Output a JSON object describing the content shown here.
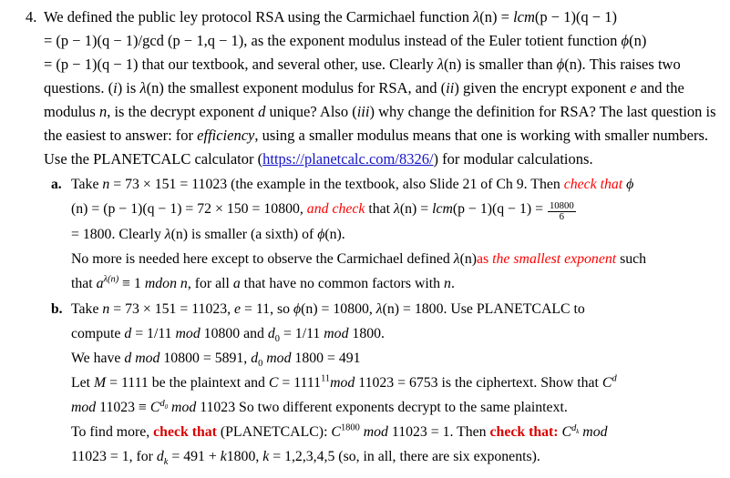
{
  "document": {
    "question_number": "4.",
    "colors": {
      "text": "#000000",
      "emphasis_red": "#ff0000",
      "bold_red": "#d90000",
      "link_blue": "#1414c8"
    },
    "intro": {
      "seg_1": "We defined the public ley protocol RSA using the  Carmichael function ",
      "lambda": "λ",
      "of_n_1": "(n) = ",
      "lcm": "lcm",
      "lcm_args": "(p − 1)(q − 1)",
      "seg_2": "= (p − 1)(q − 1)/gcd (p − 1,q − 1), as the exponent modulus instead of the Euler totient function ",
      "phi": "ϕ",
      "phi_of_n": "(n)",
      "seg_3": "= (p − 1)(q − 1) that our textbook, and several other, use. Clearly ",
      "lambda_2": "λ",
      "of_n_2": "(n) is smaller than ",
      "phi_2": "ϕ",
      "of_n_3": "(n). This raises",
      "seg_4": "two questions. (",
      "roman_i": "i",
      "seg_5": ") is ",
      "lambda_3": "λ",
      "seg_6": "(n) the smallest exponent modulus for RSA, and (",
      "roman_ii": "ii",
      "seg_7": ") given the encrypt exponent ",
      "var_e": "e",
      "seg_8": "and the modulus ",
      "var_n": "n",
      "seg_9": ", is the decrypt exponent ",
      "var_d": "d",
      "seg_10": " unique? Also (",
      "roman_iii": "iii",
      "seg_11": ") why change the definition for RSA? The",
      "seg_12": "last question is the easiest to answer: for ",
      "efficiency": "efficiency",
      "seg_13": ", using a smaller modulus means that one is working",
      "seg_14": "with smaller numbers. Use the PLANETCALC calculator (",
      "link_text": "https://planetcalc.com/8326/",
      "seg_15": ") for modular",
      "seg_16": "calculations."
    },
    "part_a": {
      "marker": "a.",
      "l1_p1": "Take ",
      "l1_n": "n",
      "l1_p2": " = 73 × 151 = 11023 (the example in the textbook, also Slide 21 of Ch 9. Then ",
      "l1_red_italic": "check that",
      "l1_phi": "ϕ",
      "l2_p1": "(n) = (p − 1)(q − 1) = 72 × 150 = 10800",
      "l2_comma": ", ",
      "l2_red_italic": "and check",
      "l2_p2": " that ",
      "l2_lambda": "λ",
      "l2_p3": "(n) = ",
      "l2_lcm": "lcm",
      "l2_p4": "(p − 1)(q − 1) = ",
      "frac_num": "10800",
      "frac_den": "6",
      "l3_p1": "= 1800. Clearly ",
      "l3_lambda": "λ",
      "l3_p2": "(n) is smaller (a sixth) of ",
      "l3_phi": "ϕ",
      "l3_p3": "(n).",
      "l4_p1": "No more is needed here except to observe the Carmichael defined ",
      "l4_lambda": "λ",
      "l4_p2": "(n)",
      "l4_red_as": "as ",
      "l4_red_italic": "the smallest exponent",
      "l4_p3": " such",
      "l5_p1": "that ",
      "l5_a": "a",
      "l5_sup_lambda": "λ(n)",
      "l5_p2": " ≡ 1 ",
      "l5_mdon": "mdon n",
      "l5_p3": ", for all ",
      "l5_a2": "a",
      "l5_p4": " that have no common factors with ",
      "l5_n": "n",
      "l5_p5": "."
    },
    "part_b": {
      "marker": "b.",
      "l1_p1": "Take ",
      "l1_n": "n",
      "l1_p2": " = 73 × 151 = 11023, ",
      "l1_e": "e",
      "l1_p3": " = 11, so  ",
      "l1_phi": "ϕ",
      "l1_p4": "(n) = 10800, ",
      "l1_lambda": "λ",
      "l1_p5": "(n) = 1800. Use PLANETCALC to",
      "l2_p1": "compute ",
      "l2_d": "d",
      "l2_p2": " = 1/11 ",
      "l2_mod": "mod",
      "l2_p3": " 10800 and ",
      "l2_d0": "d",
      "l2_d0_sub": "0",
      "l2_p4": " = 1/11 ",
      "l2_mod2": "mod",
      "l2_p5": " 1800.",
      "l3_p1": "We have ",
      "l3_d": "d",
      "l3_mod": "mod",
      "l3_p2": " 10800 = 5891, ",
      "l3_d0": "d",
      "l3_d0_sub": "0",
      "l3_mod2": "mod",
      "l3_p3": " 1800 = 491",
      "l4_p1": "Let ",
      "l4_M": "M",
      "l4_p2": " = 1111 be the plaintext and ",
      "l4_C": "C",
      "l4_p3": " = 1111",
      "l4_sup": "11",
      "l4_mod": "mod",
      "l4_p4": " 11023 = 6753 is the ciphertext. Show that ",
      "l4_C2": "C",
      "l4_sup_d": "d",
      "l5_mod": "mod",
      "l5_p1": " 11023 ≡ ",
      "l5_C": "C",
      "l5_sup_d0": "d",
      "l5_sup_d0_sub": "0",
      "l5_mod2": "mod",
      "l5_p2": " 11023 So two different exponents decrypt to the same plaintext.",
      "l6_p1": "To find more, ",
      "l6_bold_red": "check that",
      "l6_p2": " (PLANETCALC): ",
      "l6_C": "C",
      "l6_sup": "1800",
      "l6_mod": "mod",
      "l6_p3": " 11023 = 1. Then ",
      "l6_bold_red2": "check that:",
      "l6_C2": "C",
      "l6_sup_dk": "d",
      "l6_sup_dk_sub": "k",
      "l6_mod2": "mod",
      "l7_p1": "11023 = 1, for ",
      "l7_d": "d",
      "l7_d_sub": "k",
      "l7_p2": " = 491 + ",
      "l7_k": "k",
      "l7_p3": "1800,  ",
      "l7_k2": "k",
      "l7_p4": " = 1,2,3,4,5 (so, in all, there are six exponents)."
    }
  }
}
